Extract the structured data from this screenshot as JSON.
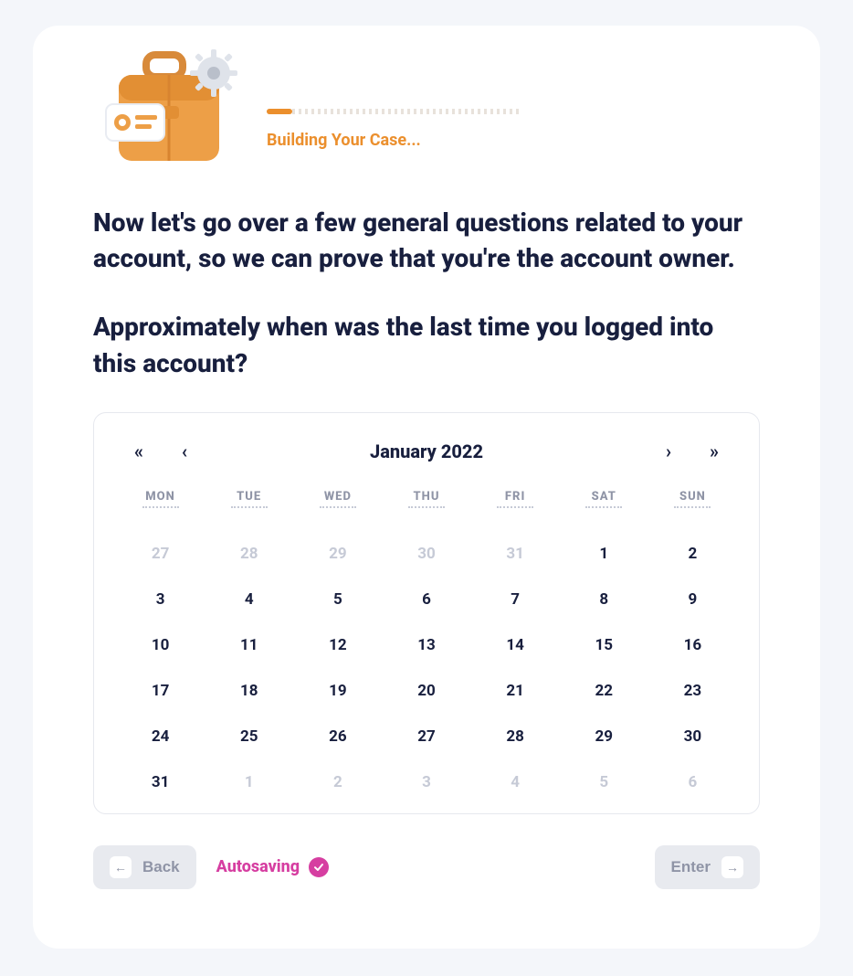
{
  "progress": {
    "label": "Building Your Case..."
  },
  "heading": "Now let's go over a few general questions related to your account, so we can prove that you're the account owner.",
  "subheading": "Approximately when was the last time you logged into this account?",
  "calendar": {
    "title": "January 2022",
    "nav": {
      "prev_year": "«",
      "prev_month": "‹",
      "next_month": "›",
      "next_year": "»"
    },
    "dow": [
      "MON",
      "TUE",
      "WED",
      "THU",
      "FRI",
      "SAT",
      "SUN"
    ],
    "cells": [
      {
        "d": "27",
        "muted": true
      },
      {
        "d": "28",
        "muted": true
      },
      {
        "d": "29",
        "muted": true
      },
      {
        "d": "30",
        "muted": true
      },
      {
        "d": "31",
        "muted": true
      },
      {
        "d": "1"
      },
      {
        "d": "2"
      },
      {
        "d": "3"
      },
      {
        "d": "4"
      },
      {
        "d": "5"
      },
      {
        "d": "6"
      },
      {
        "d": "7"
      },
      {
        "d": "8"
      },
      {
        "d": "9"
      },
      {
        "d": "10"
      },
      {
        "d": "11"
      },
      {
        "d": "12"
      },
      {
        "d": "13"
      },
      {
        "d": "14"
      },
      {
        "d": "15"
      },
      {
        "d": "16"
      },
      {
        "d": "17"
      },
      {
        "d": "18"
      },
      {
        "d": "19"
      },
      {
        "d": "20"
      },
      {
        "d": "21"
      },
      {
        "d": "22"
      },
      {
        "d": "23"
      },
      {
        "d": "24"
      },
      {
        "d": "25"
      },
      {
        "d": "26"
      },
      {
        "d": "27"
      },
      {
        "d": "28"
      },
      {
        "d": "29"
      },
      {
        "d": "30"
      },
      {
        "d": "31"
      },
      {
        "d": "1",
        "muted": true
      },
      {
        "d": "2",
        "muted": true
      },
      {
        "d": "3",
        "muted": true
      },
      {
        "d": "4",
        "muted": true
      },
      {
        "d": "5",
        "muted": true
      },
      {
        "d": "6",
        "muted": true
      }
    ]
  },
  "footer": {
    "back": "Back",
    "autosave": "Autosaving",
    "enter": "Enter"
  }
}
